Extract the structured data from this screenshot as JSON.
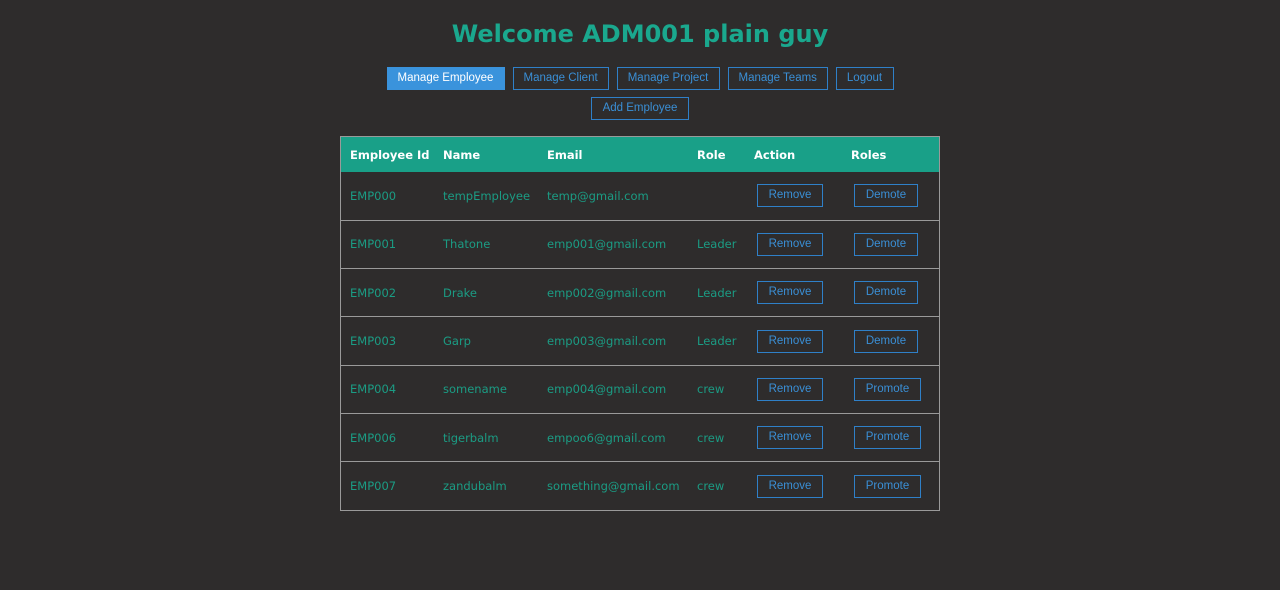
{
  "header": {
    "title": "Welcome ADM001 plain guy"
  },
  "nav": {
    "manage_employee": "Manage Employee",
    "manage_client": "Manage Client",
    "manage_project": "Manage Project",
    "manage_teams": "Manage Teams",
    "logout": "Logout",
    "add_employee": "Add Employee"
  },
  "colors": {
    "background": "#2e2c2c",
    "accent": "#1aa88e",
    "button_border": "#2f80c8",
    "active_button": "#3a93dc"
  },
  "table": {
    "headers": [
      "Employee Id",
      "Name",
      "Email",
      "Role",
      "Action",
      "Roles"
    ],
    "rows": [
      {
        "id": "EMP000",
        "name": "tempEmployee",
        "email": "temp@gmail.com",
        "role": "",
        "action": "Remove",
        "roles_action": "Demote"
      },
      {
        "id": "EMP001",
        "name": "Thatone",
        "email": "emp001@gmail.com",
        "role": "Leader",
        "action": "Remove",
        "roles_action": "Demote"
      },
      {
        "id": "EMP002",
        "name": "Drake",
        "email": "emp002@gmail.com",
        "role": "Leader",
        "action": "Remove",
        "roles_action": "Demote"
      },
      {
        "id": "EMP003",
        "name": "Garp",
        "email": "emp003@gmail.com",
        "role": "Leader",
        "action": "Remove",
        "roles_action": "Demote"
      },
      {
        "id": "EMP004",
        "name": "somename",
        "email": "emp004@gmail.com",
        "role": "crew",
        "action": "Remove",
        "roles_action": "Promote"
      },
      {
        "id": "EMP006",
        "name": "tigerbalm",
        "email": "empoo6@gmail.com",
        "role": "crew",
        "action": "Remove",
        "roles_action": "Promote"
      },
      {
        "id": "EMP007",
        "name": "zandubalm",
        "email": "something@gmail.com",
        "role": "crew",
        "action": "Remove",
        "roles_action": "Promote"
      }
    ]
  }
}
